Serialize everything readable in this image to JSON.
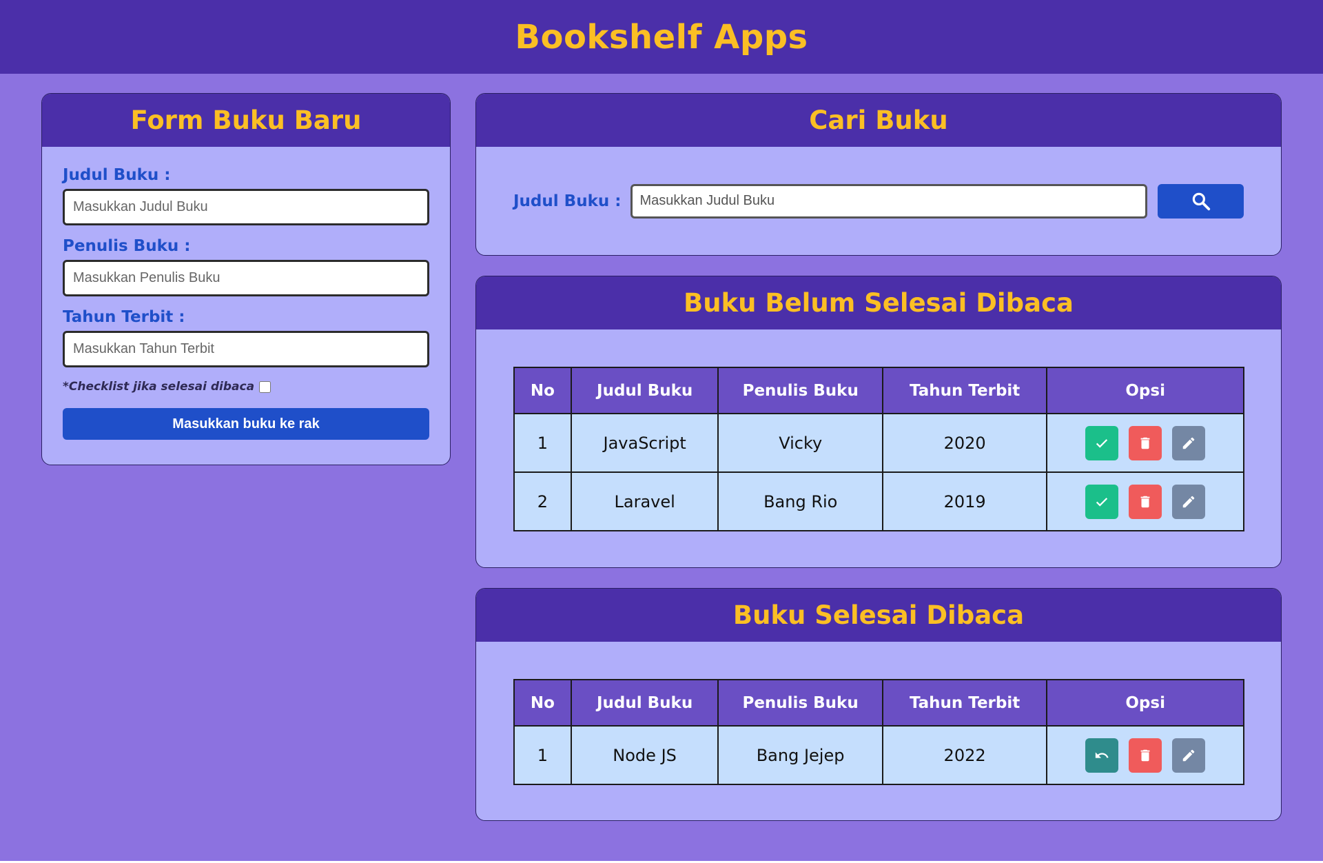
{
  "header": {
    "title": "Bookshelf Apps"
  },
  "form": {
    "title": "Form Buku Baru",
    "judul_label": "Judul Buku :",
    "judul_placeholder": "Masukkan Judul Buku",
    "penulis_label": "Penulis Buku :",
    "penulis_placeholder": "Masukkan Penulis Buku",
    "tahun_label": "Tahun Terbit :",
    "tahun_placeholder": "Masukkan Tahun Terbit",
    "checkbox_label": "*Checklist jika selesai dibaca",
    "submit_label": "Masukkan buku ke rak"
  },
  "search": {
    "title": "Cari Buku",
    "label": "Judul Buku :",
    "placeholder": "Masukkan Judul Buku",
    "button_icon": "search-icon"
  },
  "columns": [
    "No",
    "Judul Buku",
    "Penulis Buku",
    "Tahun Terbit",
    "Opsi"
  ],
  "unread": {
    "title": "Buku Belum Selesai Dibaca",
    "rows": [
      {
        "no": "1",
        "judul": "JavaScript",
        "penulis": "Vicky",
        "tahun": "2020"
      },
      {
        "no": "2",
        "judul": "Laravel",
        "penulis": "Bang Rio",
        "tahun": "2019"
      }
    ],
    "actions": [
      "check-icon",
      "trash-icon",
      "edit-icon"
    ]
  },
  "read": {
    "title": "Buku Selesai Dibaca",
    "rows": [
      {
        "no": "1",
        "judul": "Node JS",
        "penulis": "Bang Jejep",
        "tahun": "2022"
      }
    ],
    "actions": [
      "undo-icon",
      "trash-icon",
      "edit-icon"
    ]
  },
  "colors": {
    "header_bg": "#4b2fa9",
    "page_bg": "#8c72e0",
    "card_bg": "#b0aefa",
    "title_yellow": "#fbbf24",
    "primary_blue": "#1f4fc9",
    "table_header": "#6a4fc4",
    "table_cell": "#c5defd",
    "done_green": "#1bbf8a",
    "delete_red": "#f05b5b",
    "edit_gray": "#7487a4",
    "undo_teal": "#2f8c8c"
  }
}
